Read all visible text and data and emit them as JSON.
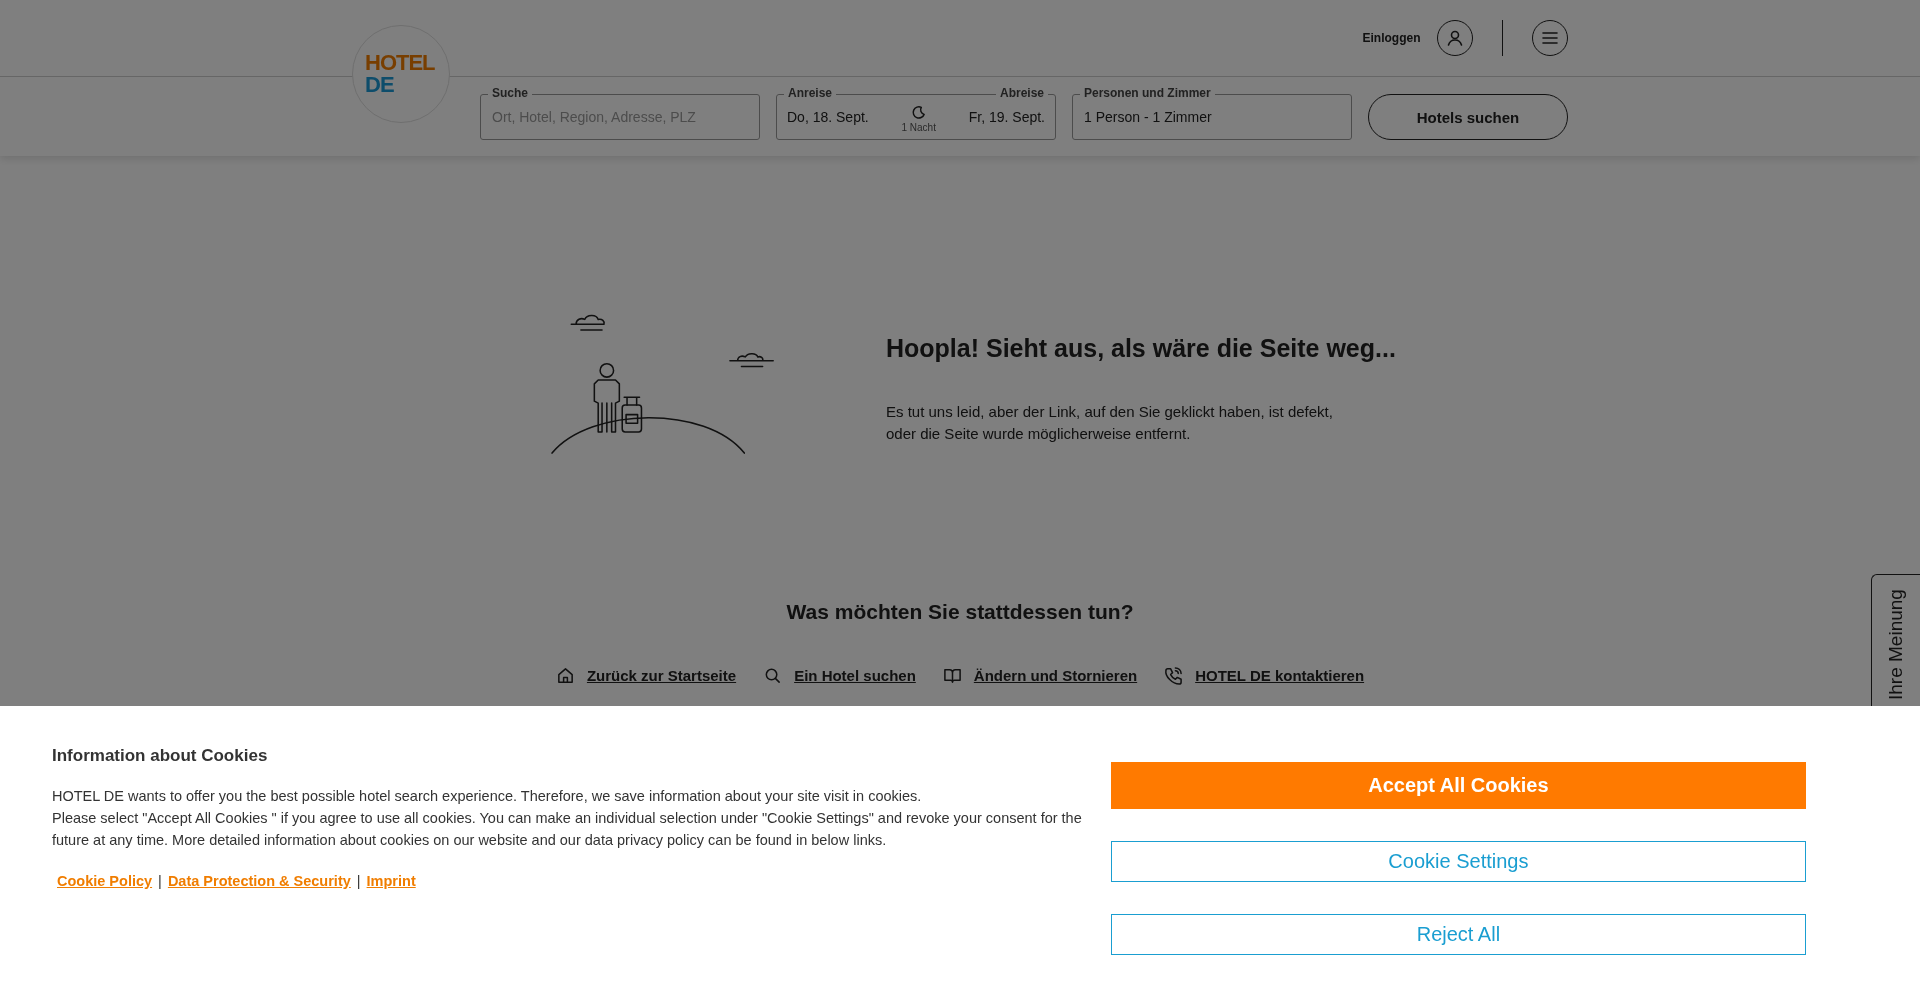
{
  "header": {
    "logo": {
      "line_1": "HOTEL",
      "line_2": "DE"
    },
    "login": "Einloggen"
  },
  "search_form": {
    "destination": {
      "label": "Suche",
      "placeholder": "Ort, Hotel, Region, Adresse, PLZ"
    },
    "dates": {
      "arrival_label": "Anreise",
      "arrival_value": "Do, 18. Sept.",
      "nights": "1 Nacht",
      "departure_label": "Abreise",
      "departure_value": "Fr, 19. Sept."
    },
    "guests": {
      "label": "Personen und Zimmer",
      "value": "1 Person - 1 Zimmer"
    },
    "submit": "Hotels suchen"
  },
  "error": {
    "heading": "Hoopla! Sieht aus, als wäre die Seite weg...",
    "text": "Es tut uns leid, aber der Link, auf den Sie geklickt haben, ist defekt, oder die Seite wurde möglicherweise entfernt."
  },
  "alternatives": {
    "heading": "Was möchten Sie stattdessen tun?",
    "links": [
      {
        "kind": "home",
        "label": "Zurück zur Startseite"
      },
      {
        "kind": "search",
        "label": "Ein Hotel suchen"
      },
      {
        "kind": "book",
        "label": "Ändern und Stornieren"
      },
      {
        "kind": "phone",
        "label": "HOTEL DE kontaktieren"
      }
    ]
  },
  "feedback_tab": "Ihre Meinung",
  "cookie_banner": {
    "title": "Information about Cookies",
    "paragraphs": [
      "HOTEL DE wants to offer you the best possible hotel search experience. Therefore, we save information about your site visit in cookies.",
      "Please select \"Accept All Cookies \" if you agree to use all cookies. You can make an individual selection under \"Cookie Settings\" and revoke your consent for the future at any time. More detailed information about cookies on our website and our data privacy policy can be found in below links."
    ],
    "links": [
      "Cookie Policy",
      "Data Protection & Security",
      "Imprint"
    ],
    "separator": "|",
    "buttons": [
      {
        "kind": "primary",
        "label": "Accept All Cookies"
      },
      {
        "kind": "outline",
        "label": "Cookie Settings"
      },
      {
        "kind": "outline",
        "label": "Reject All"
      }
    ]
  }
}
